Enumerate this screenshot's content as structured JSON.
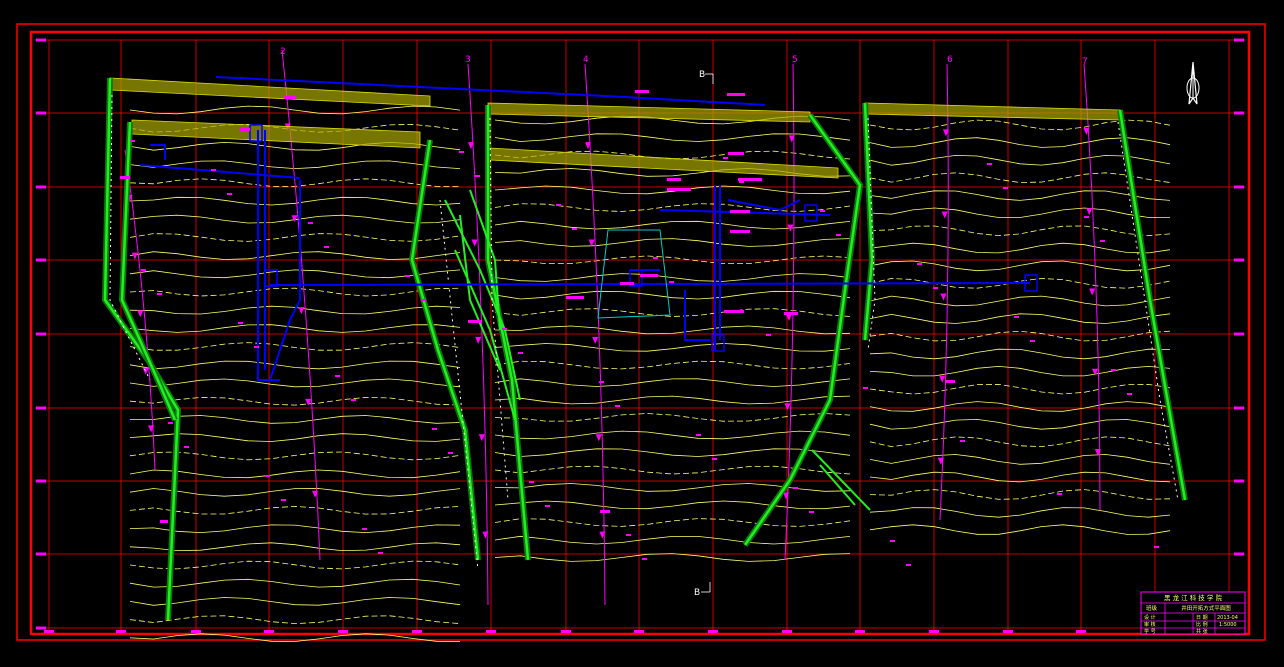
{
  "drawing": {
    "line_numbers": [
      "2",
      "3",
      "4",
      "5",
      "6",
      "7"
    ],
    "section_marker_top": "B",
    "section_marker_bottom": "B"
  },
  "title_block": {
    "org": "黑 龙 江 科 技 学 院",
    "row1": [
      "班级",
      "",
      "井田开拓方式平面图"
    ],
    "row2": [
      "设 计",
      "",
      "日 期",
      "2013-04"
    ],
    "row3": [
      "审 核",
      "",
      "比 例",
      "1:5000"
    ],
    "row4": [
      "学 号",
      "",
      "共 张",
      ""
    ]
  },
  "colors": {
    "frame": "#ff0000",
    "grid": "#ff0000",
    "contour": "#ffff66",
    "boundary": "#22ee22",
    "roadway": "#0000ff",
    "explor_line": "#ff00ff",
    "label_fill": "#ff00ff"
  },
  "icons": [
    "north-arrow-icon"
  ]
}
